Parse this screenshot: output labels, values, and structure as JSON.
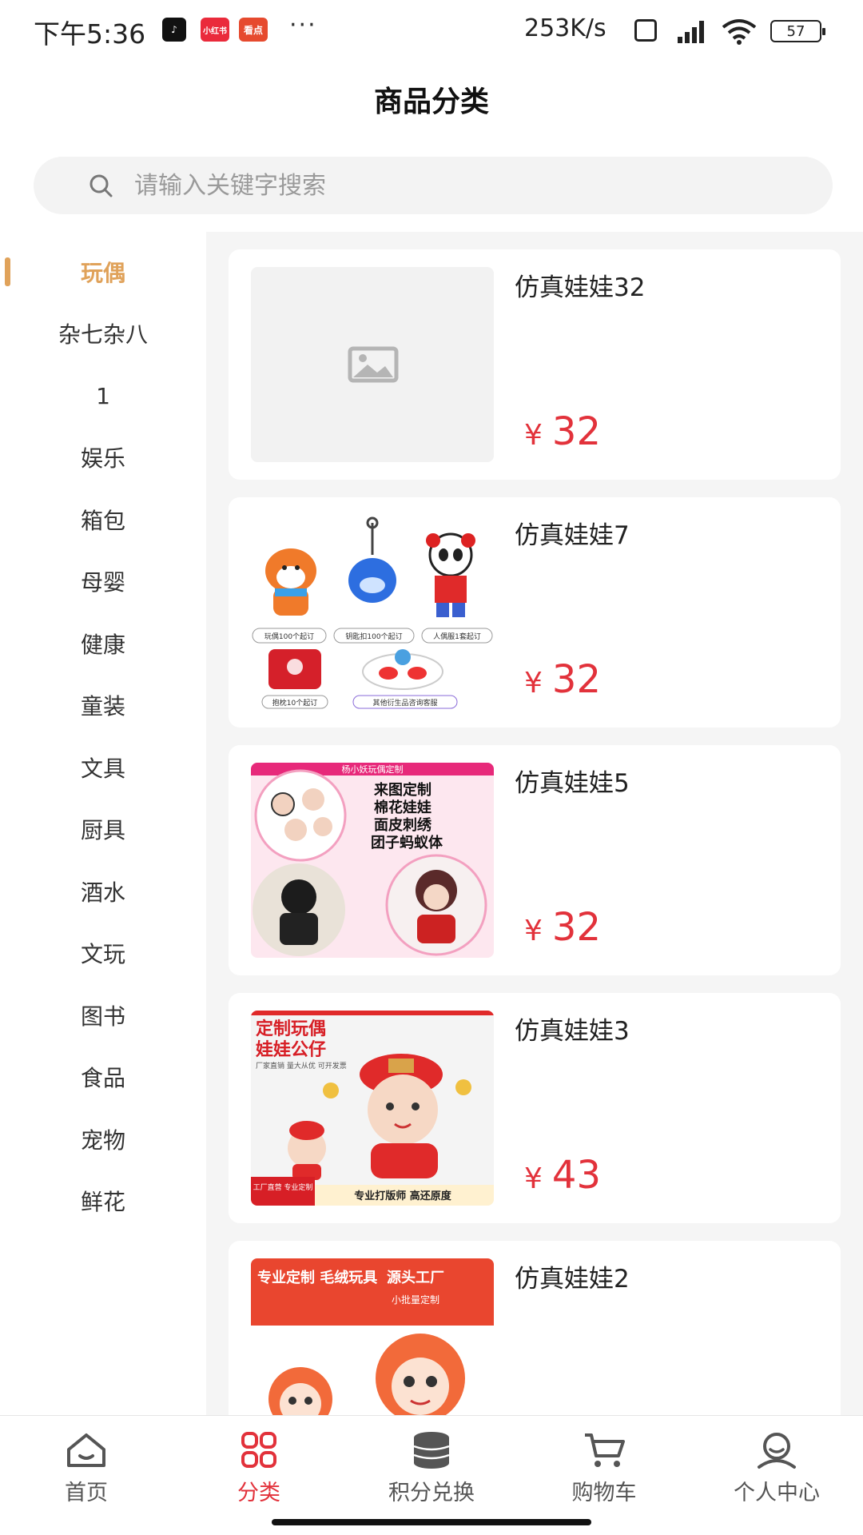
{
  "status_bar": {
    "time": "下午5:36",
    "app_icons": [
      {
        "name": "tiktok-icon",
        "label": "♪"
      },
      {
        "name": "xiaohongshu-icon",
        "label": "小红书"
      },
      {
        "name": "kandian-icon",
        "label": "看点"
      }
    ],
    "more": "···",
    "speed": "253K/s",
    "battery": "57"
  },
  "header": {
    "title": "商品分类"
  },
  "search": {
    "placeholder": "请输入关键字搜索"
  },
  "sidebar": {
    "items": [
      {
        "label": "玩偶"
      },
      {
        "label": "杂七杂八"
      },
      {
        "label": "1"
      },
      {
        "label": "娱乐"
      },
      {
        "label": "箱包"
      },
      {
        "label": "母婴"
      },
      {
        "label": "健康"
      },
      {
        "label": "童装"
      },
      {
        "label": "文具"
      },
      {
        "label": "厨具"
      },
      {
        "label": "酒水"
      },
      {
        "label": "文玩"
      },
      {
        "label": "图书"
      },
      {
        "label": "食品"
      },
      {
        "label": "宠物"
      },
      {
        "label": "鲜花"
      }
    ],
    "active_index": 0
  },
  "products": [
    {
      "name": "仿真娃娃32",
      "currency": "¥",
      "price": "32",
      "image": "placeholder"
    },
    {
      "name": "仿真娃娃7",
      "currency": "¥",
      "price": "32",
      "image": "plush-merch-collage"
    },
    {
      "name": "仿真娃娃5",
      "currency": "¥",
      "price": "32",
      "image": "custom-cotton-dolls"
    },
    {
      "name": "仿真娃娃3",
      "currency": "¥",
      "price": "43",
      "image": "custom-doll-banner"
    },
    {
      "name": "仿真娃娃2",
      "currency": "¥",
      "price": "",
      "image": "plush-toy-factory"
    }
  ],
  "product_image_text": {
    "p2_tags": [
      "玩偶100个起订",
      "钥匙扣100个起订",
      "人偶服1套起订",
      "抱枕10个起订",
      "其他衍生品咨询客服"
    ],
    "p3_title": "杨小妖玩偶定制",
    "p3_lines": [
      "来图定制",
      "棉花娃娃",
      "面皮刺绣",
      "团子蚂蚁体"
    ],
    "p4_title1": "定制玩偶",
    "p4_title2": "娃娃公仔",
    "p4_sub": "厂家直销 量大从优 可开发票",
    "p4_bottom": "专业打版师 高还原度",
    "p4_corner": "工厂直营 专业定制",
    "p5_left": "专业定制 毛绒玩具",
    "p5_right": "源头工厂",
    "p5_right_sub": "小批量定制"
  },
  "tabbar": {
    "tabs": [
      {
        "label": "首页"
      },
      {
        "label": "分类"
      },
      {
        "label": "积分兑换"
      },
      {
        "label": "购物车"
      },
      {
        "label": "个人中心"
      }
    ],
    "active_index": 1,
    "active_color": "#e2323b"
  },
  "colors": {
    "accent_orange": "#e0a25a",
    "price_red": "#e2323b"
  }
}
